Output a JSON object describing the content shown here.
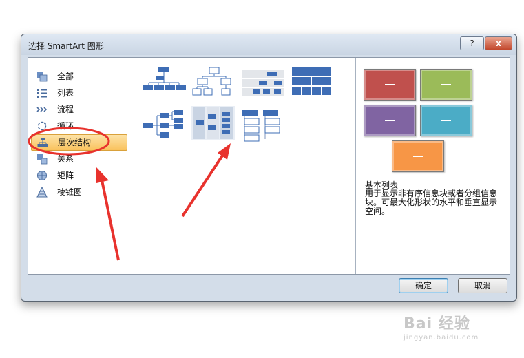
{
  "dialog": {
    "title": "选择 SmartArt 图形",
    "help_label": "?",
    "close_label": "x"
  },
  "categories": [
    {
      "label": "全部",
      "icon": "all-icon"
    },
    {
      "label": "列表",
      "icon": "list-icon"
    },
    {
      "label": "流程",
      "icon": "process-icon"
    },
    {
      "label": "循环",
      "icon": "cycle-icon"
    },
    {
      "label": "层次结构",
      "icon": "hierarchy-icon",
      "selected": true
    },
    {
      "label": "关系",
      "icon": "relationship-icon"
    },
    {
      "label": "矩阵",
      "icon": "matrix-icon"
    },
    {
      "label": "棱锥图",
      "icon": "pyramid-icon"
    }
  ],
  "layouts": [
    {
      "icon": "org-chart-layout-icon"
    },
    {
      "icon": "hierarchy-layout-icon"
    },
    {
      "icon": "labeled-hierarchy-layout-icon"
    },
    {
      "icon": "table-hierarchy-layout-icon"
    },
    {
      "icon": "horizontal-hierarchy-layout-icon"
    },
    {
      "icon": "lined-list-layout-icon"
    },
    {
      "icon": "hierarchy-list-layout-icon"
    }
  ],
  "preview": {
    "colors": [
      "#c0504d",
      "#9bbb59",
      "#8064a2",
      "#4bacc6",
      "#f79646"
    ],
    "title": "基本列表",
    "description": "用于显示非有序信息块或者分组信息块。可最大化形状的水平和垂直显示空间。"
  },
  "buttons": {
    "ok": "确定",
    "cancel": "取消"
  },
  "annotation": {
    "color": "#e8322d"
  },
  "watermark": {
    "main": "Bai 经验",
    "sub": "jingyan.baidu.com"
  }
}
